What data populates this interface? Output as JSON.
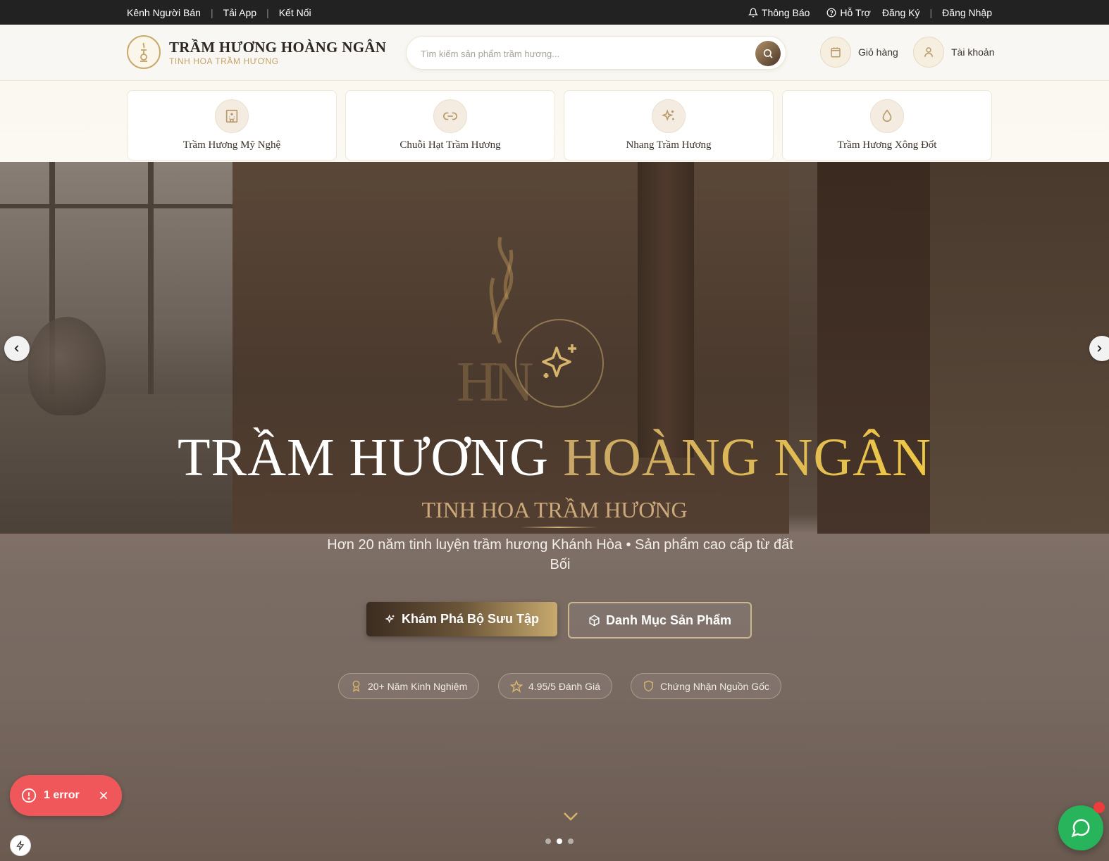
{
  "topbar": {
    "left": [
      "Kênh Người Bán",
      "Tải App",
      "Kết Nối"
    ],
    "notifications": "Thông Báo",
    "support": "Hỗ Trợ",
    "register": "Đăng Ký",
    "login": "Đăng Nhập"
  },
  "header": {
    "brand": "TRẦM HƯƠNG HOÀNG NGÂN",
    "tagline": "TINH HOA TRẦM HƯƠNG",
    "search_placeholder": "Tìm kiếm sản phẩm trầm hương...",
    "cart": "Giỏ hàng",
    "account": "Tài khoản"
  },
  "categories": [
    {
      "label": "Trầm Hương Mỹ Nghệ",
      "icon": "building-icon"
    },
    {
      "label": "Chuỗi Hạt Trầm Hương",
      "icon": "link-icon"
    },
    {
      "label": "Nhang Trầm Hương",
      "icon": "sparkles-icon"
    },
    {
      "label": "Trầm Hương Xông Đốt",
      "icon": "droplet-icon"
    }
  ],
  "hero": {
    "title_part1": "TRẦM HƯƠNG",
    "title_part2": "HOÀNG NGÂN",
    "subtitle": "TINH HOA TRẦM HƯƠNG",
    "description": "Hơn 20 năm tinh luyện trầm hương Khánh Hòa • Sản phẩm cao cấp từ đất Bối",
    "primary_cta": "Khám Phá Bộ Sưu Tập",
    "secondary_cta": "Danh Mục Sản Phẩm",
    "badges": [
      "20+ Năm Kinh Nghiệm",
      "4.95/5 Đánh Giá",
      "Chứng Nhận Nguồn Gốc"
    ],
    "slides_total": 3,
    "active_slide": 2
  },
  "error_toast": {
    "text": "1 error"
  },
  "colors": {
    "gold": "#c8aa6e",
    "dark": "#222222",
    "error": "#f0575a",
    "chat": "#27b45a"
  }
}
